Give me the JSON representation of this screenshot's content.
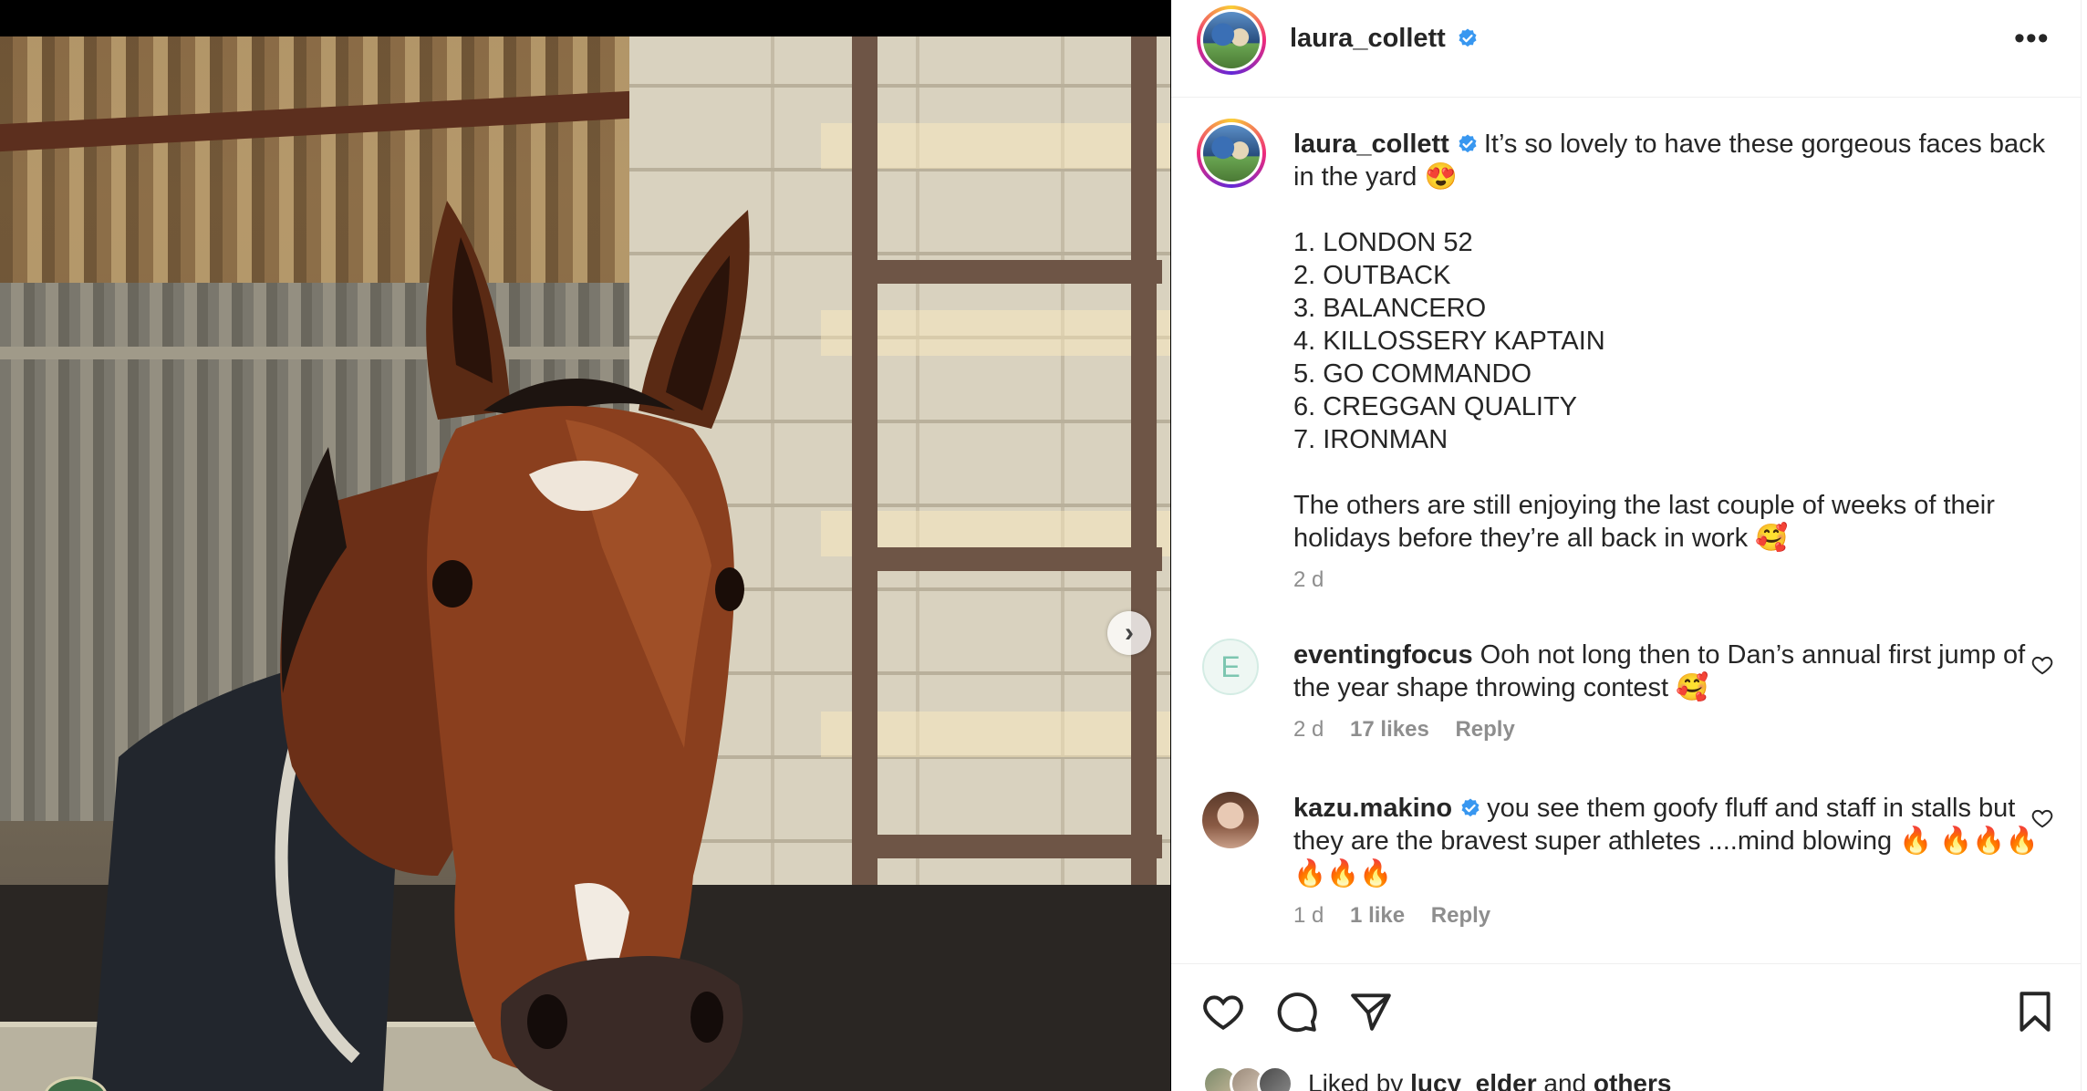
{
  "post": {
    "username": "laura_collett",
    "caption_lead": "It’s so lovely to have these gorgeous faces back in the yard 😍",
    "caption_list": [
      "1. LONDON 52",
      "2. OUTBACK",
      "3. BALANCERO",
      "4. KILLOSSERY KAPTAIN",
      "5. GO COMMANDO",
      "6. CREGGAN QUALITY",
      "7. IRONMAN"
    ],
    "caption_tail": "The others are still enjoying the last couple of weeks of their holidays before they’re all back in work 🥰",
    "caption_time": "2 d"
  },
  "comments": [
    {
      "avatar_letter": "E",
      "username": "eventingfocus",
      "text": "Ooh not long then to Dan’s annual first jump of the year shape throwing contest 🥰",
      "time": "2 d",
      "likes": "17 likes",
      "reply": "Reply"
    },
    {
      "username": "kazu.makino",
      "text": "you see them goofy fluff and staff in stalls but they are the bravest super athletes ....mind blowing 🔥 🔥🔥🔥🔥🔥🔥",
      "time": "1 d",
      "likes": "1 like",
      "reply": "Reply"
    }
  ],
  "likes_summary": {
    "prefix": "Liked by",
    "user": "lucy_elder",
    "conjunction": "and",
    "others": "others"
  },
  "media": {
    "next_glyph": "›"
  },
  "header": {
    "more_glyph": "•••"
  },
  "icons": {
    "verified": "verified-badge-icon",
    "like": "heart-icon",
    "comment": "comment-bubble-icon",
    "share": "paper-plane-icon",
    "save": "bookmark-icon",
    "more": "more-options-icon",
    "next": "chevron-right-icon"
  },
  "colors": {
    "verified_blue": "#3897f0",
    "text": "#262626",
    "muted": "#8e8e8e",
    "story_ring": "#ee2a7b"
  }
}
